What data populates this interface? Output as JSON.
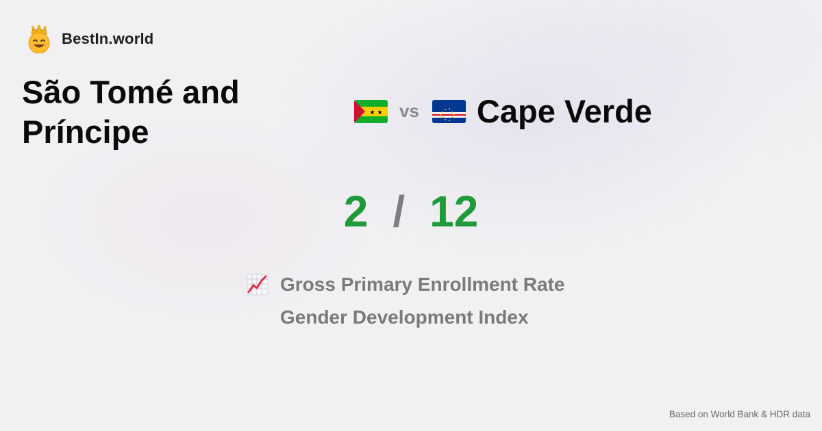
{
  "brand": {
    "name": "BestIn.world",
    "logo_icon": "crowned-smiley-icon"
  },
  "comparison": {
    "country_a": {
      "name": "São Tomé and Príncipe",
      "flag_icon": "sao-tome-flag-icon",
      "score": "2"
    },
    "vs_label": "vs",
    "country_b": {
      "name": "Cape Verde",
      "flag_icon": "cape-verde-flag-icon",
      "score": "12"
    },
    "separator": "/"
  },
  "metrics": [
    {
      "label": "Gross Primary Enrollment Rate",
      "icon": "chart-increasing-icon"
    },
    {
      "label": "Gender Development Index"
    }
  ],
  "footer": {
    "source": "Based on World Bank & HDR data"
  },
  "colors": {
    "score": "#1e9a3a",
    "muted": "#7a7a7a",
    "title": "#0a0a0a",
    "background": "#f1f1f3"
  }
}
